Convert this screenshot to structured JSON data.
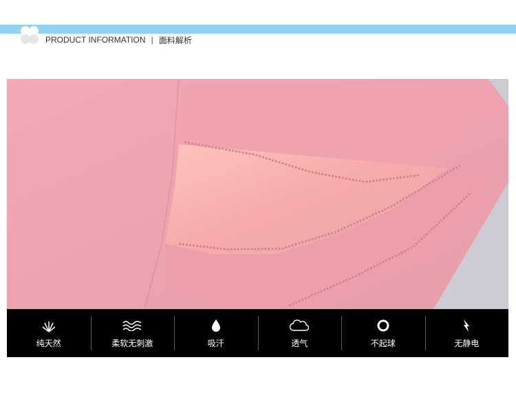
{
  "header": {
    "title_en": "PRODUCT INFORMATION",
    "separator": "|",
    "title_cn": "面料解析"
  },
  "colors": {
    "top_bar": "#8fd3f4",
    "fabric_pink": "#f2a3ae",
    "feature_bar_bg": "#000000"
  },
  "photo": {
    "subject": "fabric-close-up"
  },
  "features": [
    {
      "label": "纯天然",
      "icon": "grass-icon"
    },
    {
      "label": "柔软无刺激",
      "icon": "waves-icon"
    },
    {
      "label": "吸汗",
      "icon": "water-drop-icon"
    },
    {
      "label": "透气",
      "icon": "cloud-icon"
    },
    {
      "label": "不起球",
      "icon": "ring-icon"
    },
    {
      "label": "无静电",
      "icon": "lightning-icon"
    }
  ]
}
